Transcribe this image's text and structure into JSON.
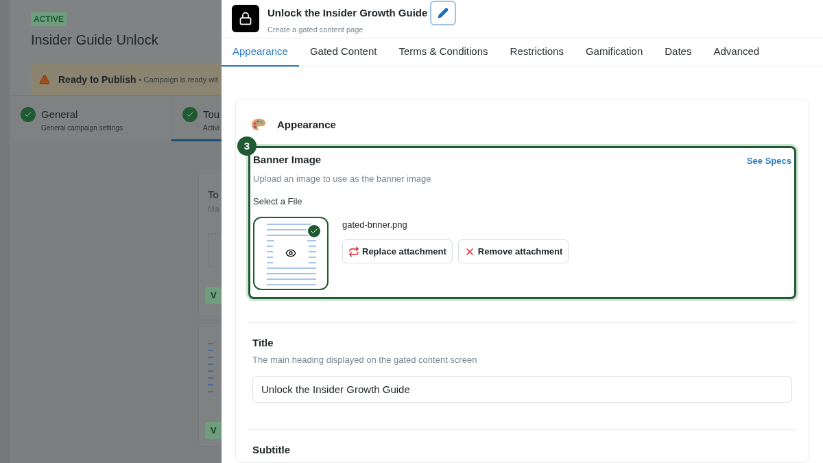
{
  "background": {
    "status_badge": "ACTIVE",
    "campaign_title": "Insider Guide Unlock",
    "alert": {
      "title": "Ready to Publish",
      "message": "• Campaign is ready wit"
    },
    "steps": [
      {
        "title": "General",
        "subtitle": "General campaign settings",
        "selected": false
      },
      {
        "title": "Tou",
        "subtitle": "Activi",
        "selected": true
      }
    ],
    "cards": [
      {
        "title": "To",
        "subtitle": "Ma",
        "tag": "V"
      },
      {
        "tag": "V"
      }
    ]
  },
  "panel": {
    "title": "Unlock the Insider Growth Guide",
    "subtitle": "Create a gated content page",
    "tabs": [
      {
        "label": "Appearance",
        "selected": true
      },
      {
        "label": "Gated Content",
        "selected": false
      },
      {
        "label": "Terms & Conditions",
        "selected": false
      },
      {
        "label": "Restrictions",
        "selected": false
      },
      {
        "label": "Gamification",
        "selected": false
      },
      {
        "label": "Dates",
        "selected": false
      },
      {
        "label": "Advanced",
        "selected": false
      }
    ],
    "section_title": "Appearance",
    "banner": {
      "step": "3",
      "title": "Banner Image",
      "link": "See Specs",
      "description": "Upload an image to use as the banner image",
      "file_label": "Select a File",
      "file_name": "gated-bnner.png",
      "uploaded": true,
      "buttons": [
        {
          "kind": "replace",
          "label": "Replace attachment"
        },
        {
          "kind": "remove",
          "label": "Remove attachment"
        }
      ]
    },
    "title_field": {
      "label": "Title",
      "description": "The main heading displayed on the gated content screen",
      "value": "Unlock the Insider Growth Guide"
    },
    "subtitle_field": {
      "label": "Subtitle"
    }
  }
}
